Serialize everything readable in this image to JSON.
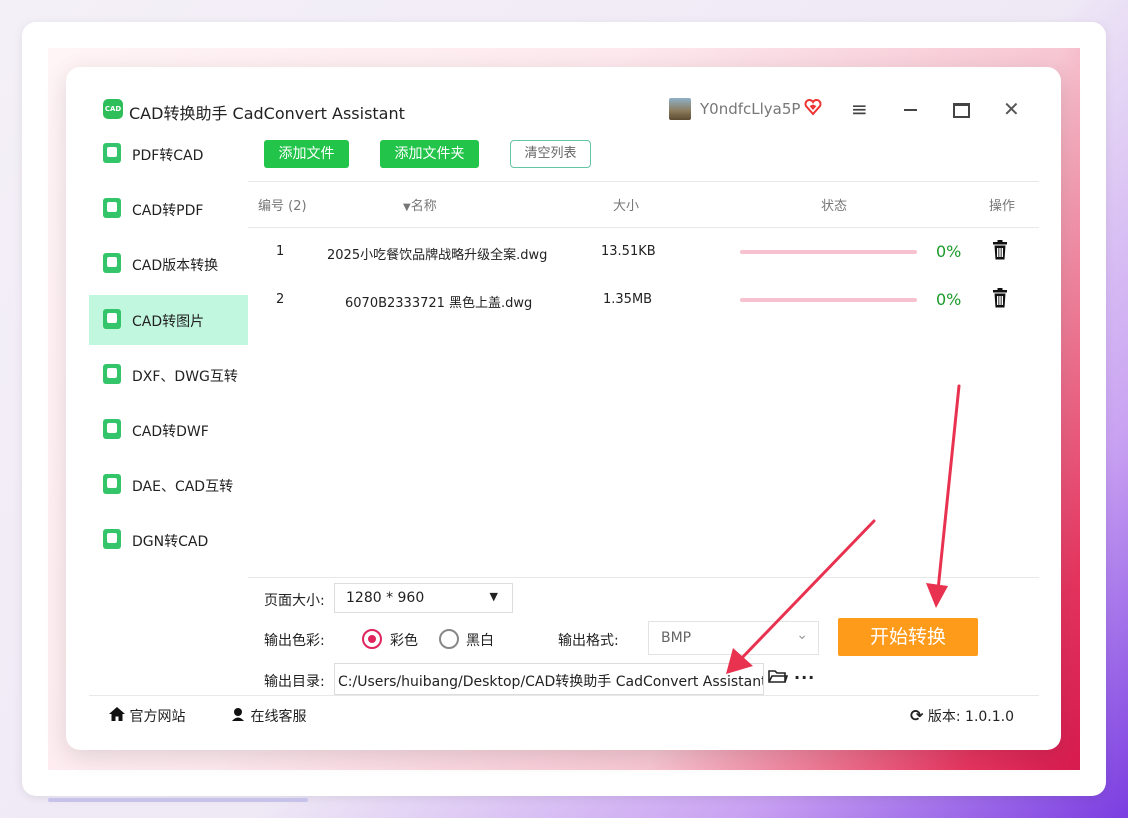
{
  "app": {
    "logo_text": "CAD",
    "title": "CAD转换助手 CadConvert Assistant",
    "user_name": "Y0ndfcLlya5P"
  },
  "sidebar": {
    "items": [
      {
        "label": "PDF转CAD",
        "active": false
      },
      {
        "label": "CAD转PDF",
        "active": false
      },
      {
        "label": "CAD版本转换",
        "active": false
      },
      {
        "label": "CAD转图片",
        "active": true
      },
      {
        "label": "DXF、DWG互转",
        "active": false
      },
      {
        "label": "CAD转DWF",
        "active": false
      },
      {
        "label": "DAE、CAD互转",
        "active": false
      },
      {
        "label": "DGN转CAD",
        "active": false
      }
    ]
  },
  "toolbar": {
    "add_file": "添加文件",
    "add_folder": "添加文件夹",
    "clear_list": "清空列表"
  },
  "table": {
    "headers": {
      "index": "编号 (2)",
      "name": "名称",
      "size": "大小",
      "status": "状态",
      "action": "操作"
    },
    "rows": [
      {
        "index": "1",
        "name": "2025小吃餐饮品牌战略升级全案.dwg",
        "size": "13.51KB",
        "progress": 0,
        "percent": "0%"
      },
      {
        "index": "2",
        "name": "6070B2333721 黑色上盖.dwg",
        "size": "1.35MB",
        "progress": 0,
        "percent": "0%"
      }
    ]
  },
  "settings": {
    "page_size_label": "页面大小:",
    "page_size_value": "1280 * 960",
    "color_label": "输出色彩:",
    "color_option_color": "彩色",
    "color_option_bw": "黑白",
    "color_selected": "彩色",
    "format_label": "输出格式:",
    "format_value": "BMP",
    "dir_label": "输出目录:",
    "dir_value": "C:/Users/huibang/Desktop/CAD转换助手 CadConvert Assistant",
    "start_button": "开始转换"
  },
  "footer": {
    "website": "官方网站",
    "support": "在线客服",
    "version_label": "版本:",
    "version_value": "1.0.1.0"
  },
  "colors": {
    "accent_green": "#22c449",
    "sidebar_active": "#c1f7df",
    "start_orange": "#ff9b1a",
    "percent_green": "#1a9a2a",
    "annotation_red": "#e8324f"
  },
  "icons": {
    "vip": "heart-badge-icon",
    "menu": "hamburger-icon",
    "minimize": "minimize-icon",
    "maximize": "maximize-icon",
    "close": "close-icon",
    "delete": "trash-icon",
    "folder": "folder-icon",
    "more": "ellipsis-icon",
    "home": "home-icon",
    "support": "headset-icon",
    "refresh": "refresh-icon"
  }
}
